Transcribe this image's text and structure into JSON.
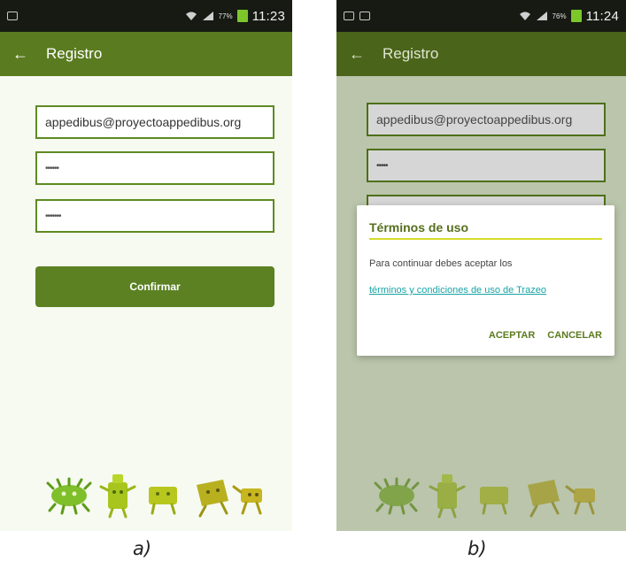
{
  "screens": [
    {
      "status_bar": {
        "battery_percent": "77%",
        "time": "11:23"
      },
      "app_bar": {
        "title": "Registro"
      },
      "form": {
        "email_value": "appedibus@proyectoappedibus.org",
        "password_value": "••••••",
        "password_confirm_value": "•••••••",
        "confirm_label": "Confirmar"
      },
      "caption": "a)"
    },
    {
      "status_bar": {
        "battery_percent": "76%",
        "time": "11:24"
      },
      "app_bar": {
        "title": "Registro"
      },
      "form": {
        "email_value": "appedibus@proyectoappedibus.org",
        "password_value": "•••••"
      },
      "dialog": {
        "title": "Términos de uso",
        "message": "Para continuar debes aceptar los",
        "link": "términos y condiciones de uso de Trazeo",
        "accept_label": "ACEPTAR",
        "cancel_label": "CANCELAR"
      },
      "caption": "b)"
    }
  ],
  "colors": {
    "app_bar": "#5a7b1f",
    "status_bar": "#161a13",
    "field_border": "#5e8a22",
    "button": "#5b8123",
    "dialog_rule": "#d6dc2a",
    "link": "#1aa3a6"
  },
  "icons": [
    "back-arrow-icon",
    "notification-icon",
    "wifi-icon",
    "signal-icon",
    "battery-icon",
    "image-icon"
  ]
}
